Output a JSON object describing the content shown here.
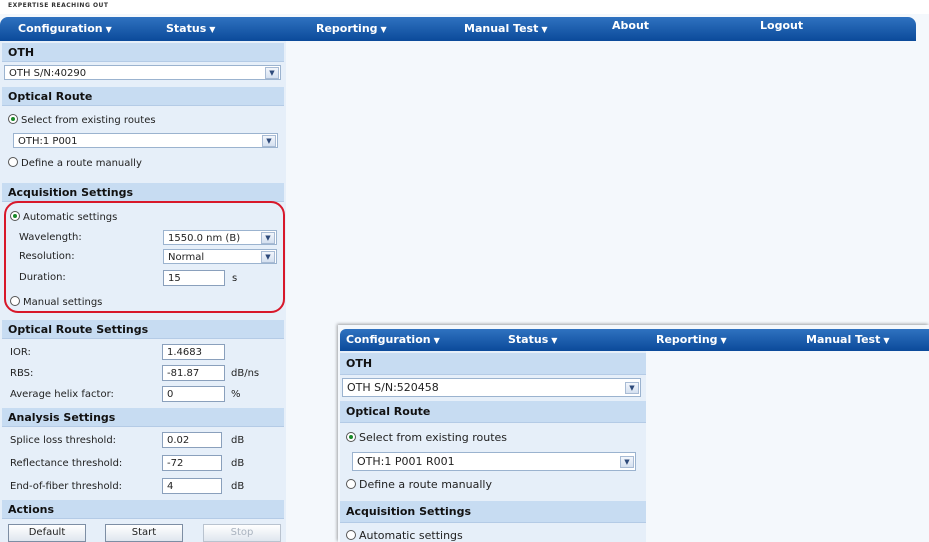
{
  "header": {
    "tagline": "EXPERTISE REACHING OUT"
  },
  "menu": {
    "configuration": "Configuration",
    "status": "Status",
    "reporting": "Reporting",
    "manual_test": "Manual Test",
    "about": "About",
    "logout": "Logout"
  },
  "left": {
    "oth_title": "OTH",
    "oth_select": "OTH S/N:40290",
    "optical_route_title": "Optical Route",
    "route_existing": "Select from existing routes",
    "route_select": "OTH:1 P001",
    "route_manual": "Define a route manually",
    "acq_title": "Acquisition Settings",
    "auto_settings": "Automatic settings",
    "wavelength_label": "Wavelength:",
    "wavelength_value": "1550.0 nm (B)",
    "resolution_label": "Resolution:",
    "resolution_value": "Normal",
    "duration_label": "Duration:",
    "duration_value": "15",
    "duration_unit": "s",
    "manual_settings": "Manual settings",
    "ors_title": "Optical Route Settings",
    "ior_label": "IOR:",
    "ior_value": "1.4683",
    "rbs_label": "RBS:",
    "rbs_value": "-81.87",
    "rbs_unit": "dB/ns",
    "helix_label": "Average helix factor:",
    "helix_value": "0",
    "helix_unit": "%",
    "analysis_title": "Analysis Settings",
    "splice_label": "Splice loss threshold:",
    "splice_value": "0.02",
    "splice_unit": "dB",
    "refl_label": "Reflectance threshold:",
    "refl_value": "-72",
    "refl_unit": "dB",
    "eof_label": "End-of-fiber threshold:",
    "eof_value": "4",
    "eof_unit": "dB",
    "actions_title": "Actions",
    "default_btn": "Default",
    "start_btn": "Start",
    "stop_btn": "Stop"
  },
  "overlay": {
    "menu": {
      "configuration": "Configuration",
      "status": "Status",
      "reporting": "Reporting",
      "manual_test": "Manual Test"
    },
    "oth_title": "OTH",
    "oth_select": "OTH S/N:520458",
    "optical_route_title": "Optical Route",
    "route_existing": "Select from existing routes",
    "route_select": "OTH:1 P001 R001",
    "route_manual": "Define a route manually",
    "acq_title": "Acquisition Settings",
    "auto_settings": "Automatic settings"
  },
  "colors": {
    "menu_blue": "#0b4a9a",
    "section_blue": "#c7dcf2",
    "highlight_red": "#d8182a",
    "radio_green": "#1a8a2a"
  },
  "icons": [
    "chevron-down-icon",
    "radio-selected-icon",
    "radio-unselected-icon"
  ]
}
